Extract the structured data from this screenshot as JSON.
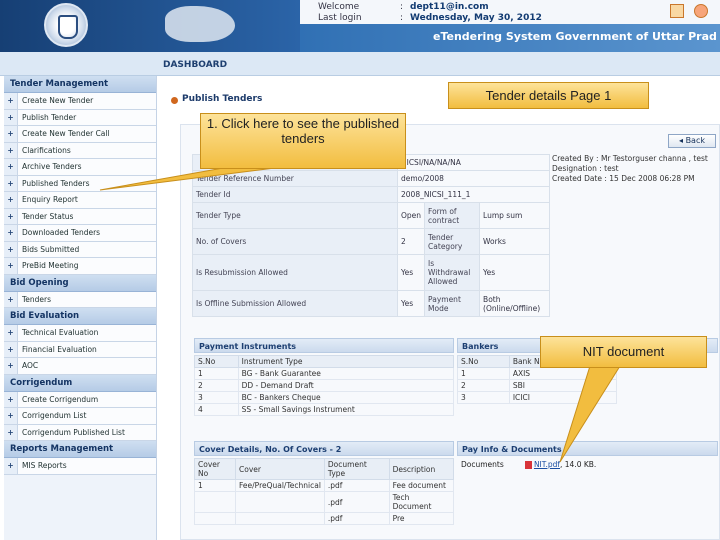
{
  "header": {
    "welcome_label": "Welcome",
    "welcome_value": "dept11@in.com",
    "last_login_label": "Last login",
    "last_login_value": "Wednesday, May 30, 2012",
    "app_title": "eTendering System Government of Uttar Prad"
  },
  "dashboard": {
    "label": "DASHBOARD"
  },
  "sidebar": {
    "sections": [
      {
        "title": "Tender Management",
        "items": [
          "Create New Tender",
          "Publish Tender",
          "Create New Tender Call",
          "Clarifications",
          "Archive Tenders",
          "Published Tenders",
          "Enquiry Report",
          "Tender Status",
          "Downloaded Tenders",
          "Bids Submitted",
          "PreBid Meeting"
        ]
      },
      {
        "title": "Bid Opening",
        "items": [
          "Tenders"
        ]
      },
      {
        "title": "Bid Evaluation",
        "items": [
          "Technical Evaluation",
          "Financial Evaluation",
          "AOC"
        ]
      },
      {
        "title": "Corrigendum",
        "items": [
          "Create Corrigendum",
          "Corrigendum List",
          "Corrigendum Published List"
        ]
      },
      {
        "title": "Reports Management",
        "items": [
          "MIS Reports"
        ]
      }
    ]
  },
  "main": {
    "page_title": "Publish Tenders",
    "back_label": "Back",
    "details": {
      "row1": {
        "value": "NICSI/NA/NA/NA"
      },
      "tender_reference": {
        "label": "Tender Reference Number",
        "value": "demo/2008"
      },
      "tender_id": {
        "label": "Tender Id",
        "value": "2008_NICSI_111_1"
      },
      "tender_type": {
        "label": "Tender Type",
        "value": "Open",
        "sub_label": "Form of contract",
        "sub_value": "Lump sum"
      },
      "covers": {
        "label": "No. of Covers",
        "value": "2",
        "sub_label": "Tender Category",
        "sub_value": "Works"
      },
      "resubmission": {
        "label": "Is Resubmission Allowed",
        "value": "Yes",
        "sub_label": "Is Withdrawal Allowed",
        "sub_value": "Yes"
      },
      "offline": {
        "label": "Is Offline Submission Allowed",
        "value": "Yes",
        "sub_label": "Payment Mode",
        "sub_value": "Both (Online/Offline)"
      }
    },
    "created_info": {
      "created_by": "Created By : Mr Testorguser channa , test",
      "designation": "Designation : test",
      "created_date": "Created Date : 15 Dec 2008 06:28 PM"
    },
    "payment_instruments": {
      "title": "Payment Instruments",
      "headers": [
        "S.No",
        "Instrument Type"
      ],
      "rows": [
        [
          "1",
          "BG - Bank Guarantee"
        ],
        [
          "2",
          "DD - Demand Draft"
        ],
        [
          "3",
          "BC - Bankers Cheque"
        ],
        [
          "4",
          "SS - Small Savings Instrument"
        ]
      ]
    },
    "bankers": {
      "title": "Bankers",
      "headers": [
        "S.No",
        "Bank Name"
      ],
      "rows": [
        [
          "1",
          "AXIS"
        ],
        [
          "2",
          "SBI"
        ],
        [
          "3",
          "ICICI"
        ]
      ]
    },
    "cover_details": {
      "title": "Cover Details, No. Of Covers - 2",
      "headers": [
        "Cover No",
        "Cover",
        "Document Type",
        "Description"
      ],
      "rows": [
        [
          "1",
          "Fee/PreQual/Technical",
          ".pdf",
          "Fee document"
        ],
        [
          "",
          "",
          ".pdf",
          "Tech Document"
        ],
        [
          "",
          "",
          ".pdf",
          "Pre"
        ]
      ]
    },
    "pay_info": {
      "title": "Pay Info & Documents",
      "documents_label": "Documents",
      "document_link": "NIT.pdf",
      "document_size": "14.0 KB."
    }
  },
  "callouts": {
    "published": "1. Click here to see the published tenders",
    "tender_details": "Tender details Page 1",
    "nit_document": "NIT document"
  }
}
